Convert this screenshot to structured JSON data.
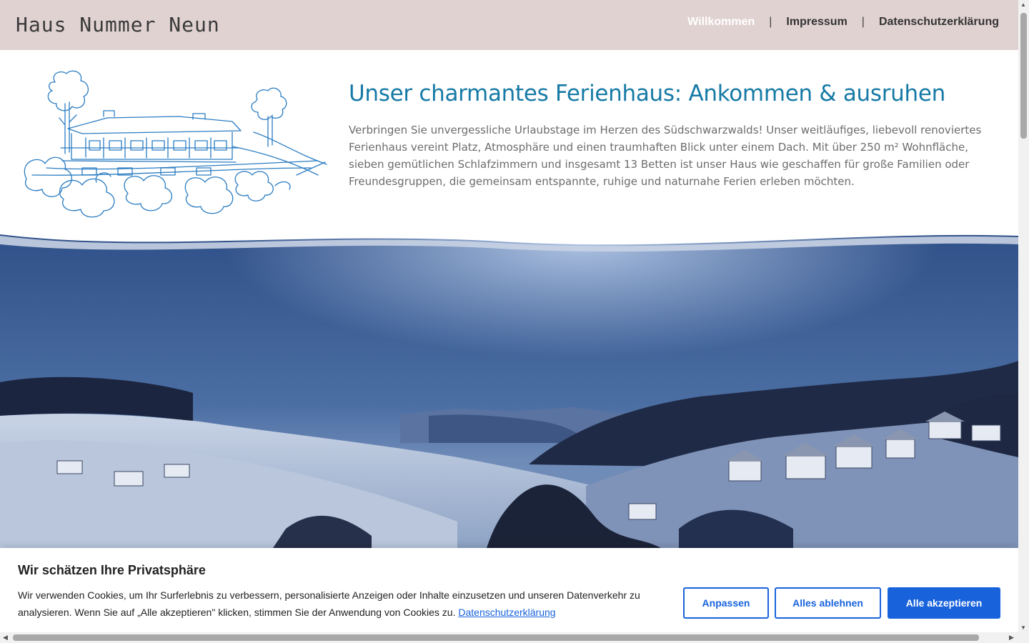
{
  "header": {
    "logo": "Haus Nummer Neun",
    "nav": [
      {
        "label": "Willkommen",
        "active": true
      },
      {
        "label": "Impressum",
        "active": false
      },
      {
        "label": "Datenschutzerklärung",
        "active": false
      }
    ],
    "separator": "|",
    "background": "#e1d2d2"
  },
  "intro": {
    "title": "Unser charmantes Ferienhaus: Ankommen & ausruhen",
    "text": "Verbringen Sie unvergessliche Urlaubstage im Herzen des Südschwarzwalds! Unser weitläufiges, liebevoll renoviertes Ferienhaus vereint Platz, Atmosphäre und einen traumhaften Blick unter einem Dach. Mit über 250 m² Wohnfläche, sieben gemütlichen Schlafzimmern und insgesamt 13 Betten ist unser Haus wie geschaffen für große Familien oder Freundesgruppen, die gemeinsam entspannte, ruhige und naturnahe Ferien erleben möchten.",
    "title_color": "#167aa6"
  },
  "images": {
    "sketch": "house-sketch-illustration",
    "photo": "winter-landscape-photo"
  },
  "cookie": {
    "title": "Wir schätzen Ihre Privatsphäre",
    "text": "Wir verwenden Cookies, um Ihr Surferlebnis zu verbessern, personalisierte Anzeigen oder Inhalte einzusetzen und unseren Datenverkehr zu analysieren. Wenn Sie auf „Alle akzeptieren\" klicken, stimmen Sie der Anwendung von Cookies zu.",
    "link": "Datenschutzerklärung",
    "buttons": {
      "customize": "Anpassen",
      "reject": "Alles ablehnen",
      "accept": "Alle akzeptieren"
    },
    "accent": "#1863dc"
  }
}
